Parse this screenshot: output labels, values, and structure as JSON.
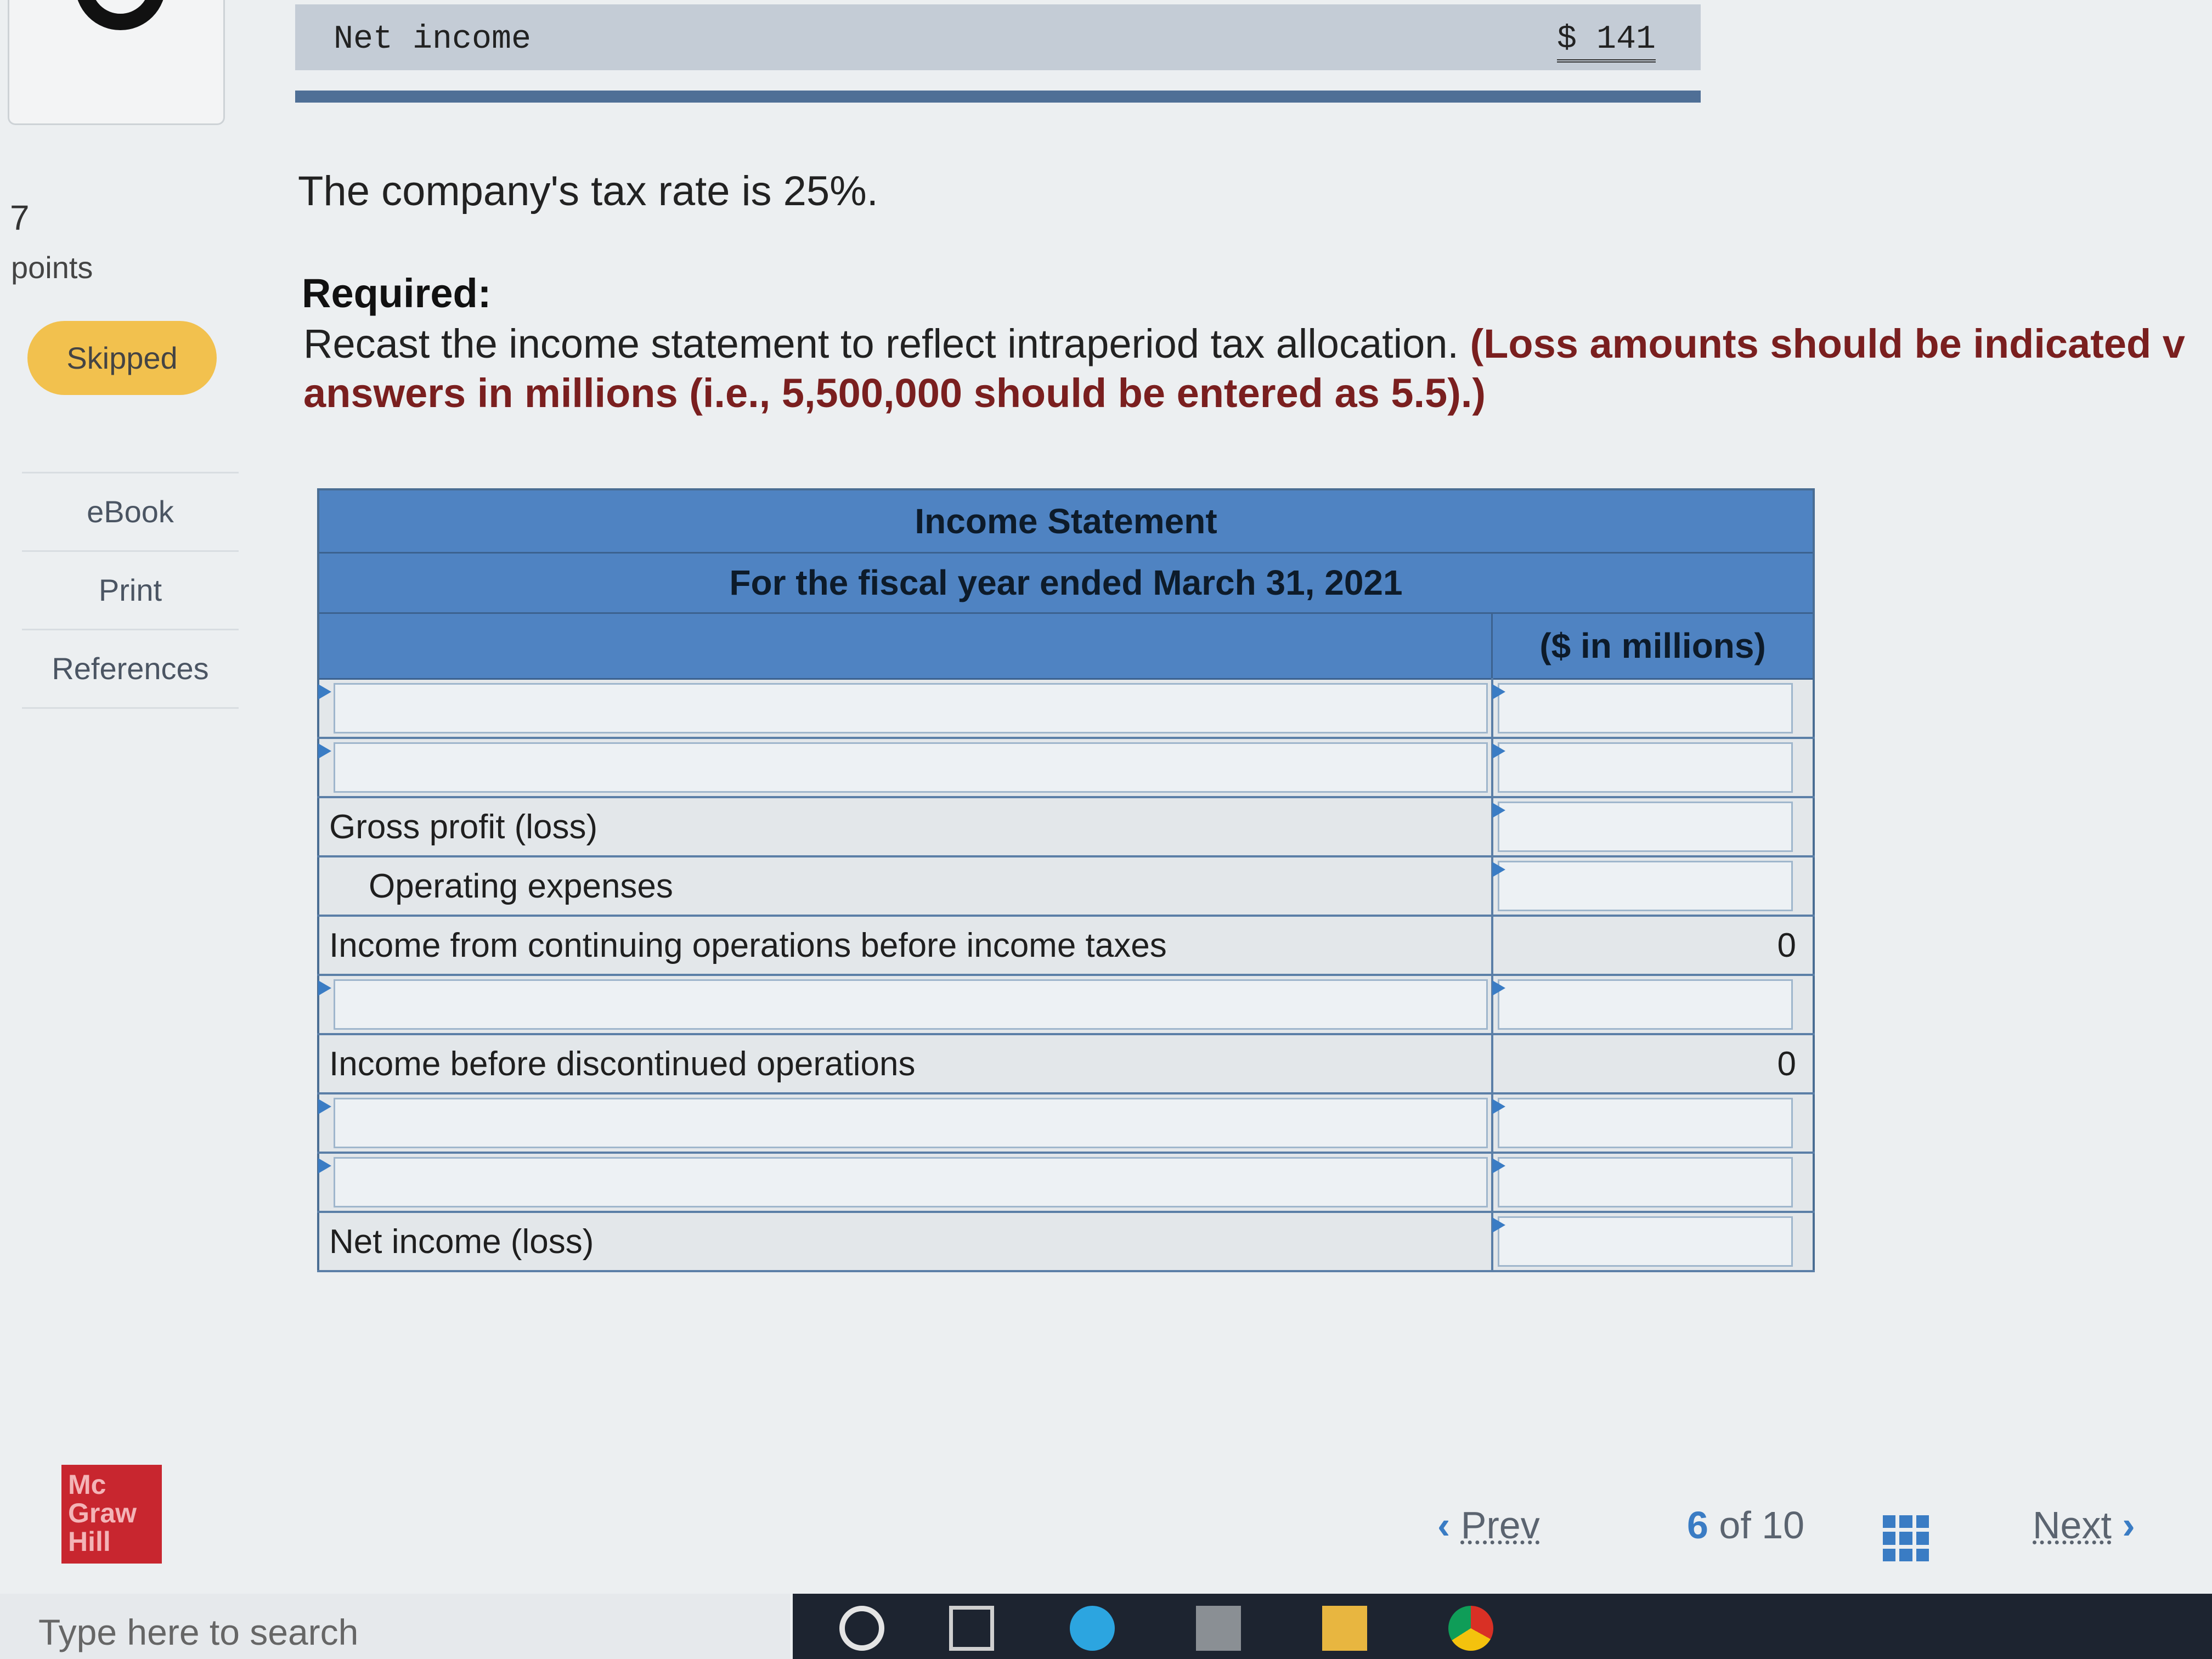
{
  "top_bar": {
    "net_income_label": "Net income",
    "net_income_value": "$ 141"
  },
  "question": {
    "number": "7",
    "points_label": "points",
    "status": "Skipped"
  },
  "side_links": [
    "eBook",
    "Print",
    "References"
  ],
  "instructions": {
    "tax_rate_text": "The company's tax rate is 25%.",
    "required_title": "Required:",
    "required_text": "Recast the income statement to reflect intraperiod tax allocation.",
    "required_emphasis_1": "(Loss amounts should be indicated v",
    "required_emphasis_2": "answers in millions (i.e., 5,500,000 should be entered as 5.5).)"
  },
  "statement": {
    "title": "Income Statement",
    "period": "For the fiscal year ended March 31, 2021",
    "units_header": "($ in millions)",
    "rows": [
      {
        "label": "",
        "amount": ""
      },
      {
        "label": "",
        "amount": ""
      },
      {
        "label": "Gross profit (loss)",
        "amount": ""
      },
      {
        "label": "Operating expenses",
        "amount": ""
      },
      {
        "label": "Income from continuing operations before income taxes",
        "amount": "0"
      },
      {
        "label": "",
        "amount": ""
      },
      {
        "label": "Income before discontinued operations",
        "amount": "0"
      },
      {
        "label": "",
        "amount": ""
      },
      {
        "label": "",
        "amount": ""
      },
      {
        "label": "Net income (loss)",
        "amount": ""
      }
    ]
  },
  "pager": {
    "prev_label": "Prev",
    "current_page": "6",
    "of_total": "of 10",
    "next_label": "Next"
  },
  "brand": {
    "logo_text": "Mc Graw Hill"
  },
  "taskbar": {
    "search_placeholder": "Type here to search"
  }
}
